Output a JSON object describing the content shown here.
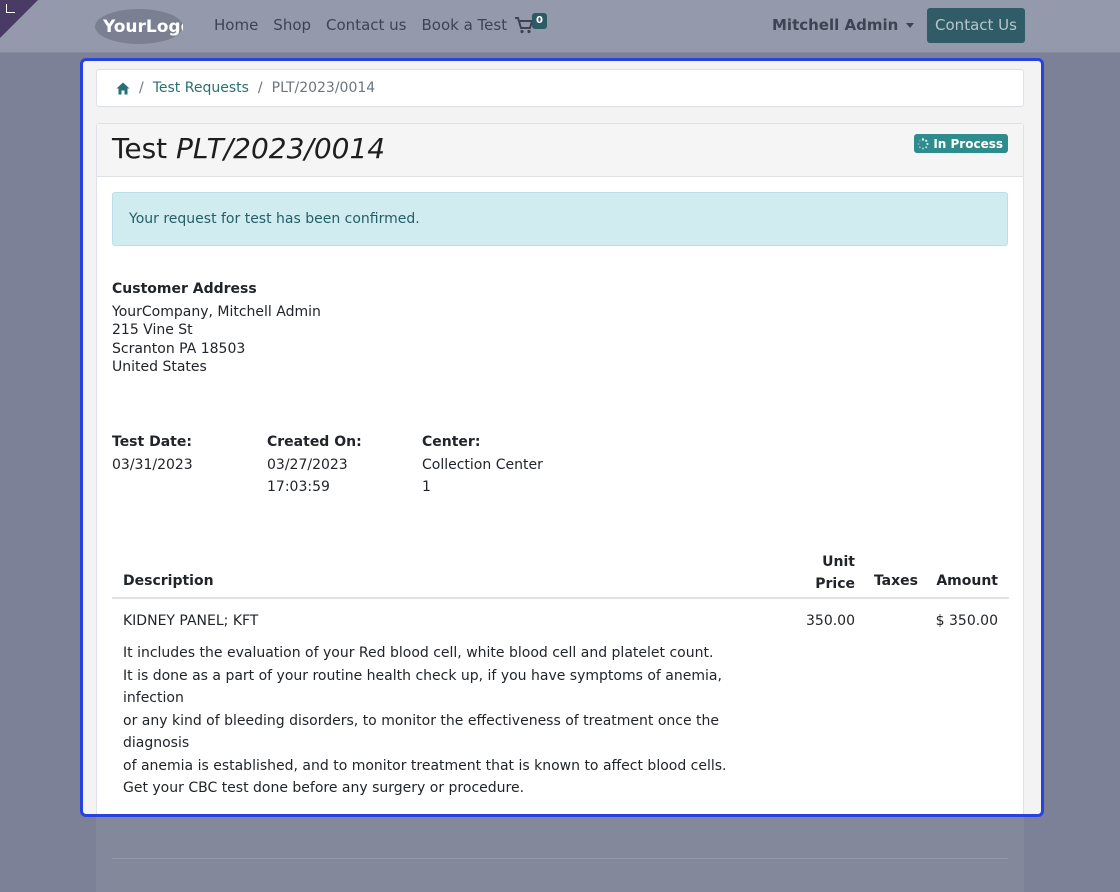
{
  "navbar": {
    "logo_text": "YourLogo",
    "links": [
      "Home",
      "Shop",
      "Contact us",
      "Book a Test"
    ],
    "cart_count": "0",
    "user_name": "Mitchell Admin",
    "contact_button": "Contact Us"
  },
  "breadcrumb": {
    "home_icon": "home-icon",
    "items": [
      "Test Requests",
      "PLT/2023/0014"
    ]
  },
  "header": {
    "title_prefix": "Test",
    "title_ref": "PLT/2023/0014",
    "status": "In Process",
    "status_icon": "spinner-icon",
    "status_color": "#2f8c8c"
  },
  "alert": {
    "message": "Your request for test has been confirmed."
  },
  "customer": {
    "label": "Customer Address",
    "lines": [
      "YourCompany, Mitchell Admin",
      "215 Vine St",
      "Scranton PA 18503",
      "United States"
    ]
  },
  "details": {
    "test_date_label": "Test Date:",
    "test_date": "03/31/2023",
    "created_label": "Created On:",
    "created_date": "03/27/2023",
    "created_time": "17:03:59",
    "center_label": "Center:",
    "center_line1": "Collection Center",
    "center_line2": "1"
  },
  "table": {
    "headers": {
      "description": "Description",
      "unit_price_1": "Unit",
      "unit_price_2": "Price",
      "taxes": "Taxes",
      "amount": "Amount"
    },
    "rows": [
      {
        "description": "KIDNEY PANEL; KFT",
        "unit_price": "350.00",
        "taxes": "",
        "amount": "$ 350.00"
      }
    ],
    "description_lines": [
      "It includes the evaluation of your Red blood cell, white blood cell and platelet count.",
      "It is done as a part of your routine health check up, if you have symptoms of anemia, infection",
      "or any kind of bleeding disorders, to monitor the effectiveness of treatment once the",
      "diagnosis",
      "of anemia is established, and to monitor treatment that is known to affect blood cells.",
      "Get your CBC test done before any surgery or procedure."
    ]
  }
}
